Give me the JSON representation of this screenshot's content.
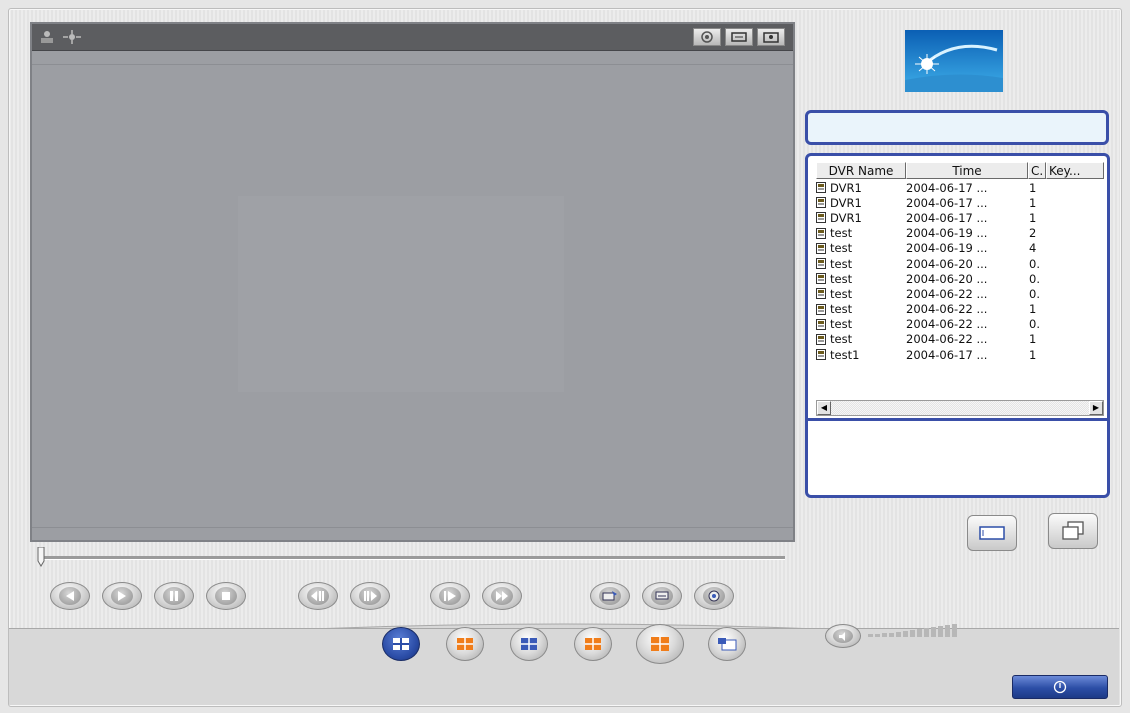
{
  "window": {
    "accent": "#3a4fa8",
    "video_bg": "#9c9ea3"
  },
  "video_toolbar": {
    "left_icons": [
      "network-icon",
      "ptz-icon"
    ],
    "right_buttons": [
      "snapshot-icon",
      "print-icon",
      "record-icon"
    ]
  },
  "playback": {
    "slider_position": 0,
    "controls": [
      "rewind-icon",
      "play-icon",
      "pause-icon",
      "stop-icon",
      "step-back-icon",
      "step-forward-icon",
      "slow-icon",
      "fast-icon",
      "save-clip-icon",
      "print-icon",
      "snapshot-icon"
    ]
  },
  "split_modes": [
    "split-1-icon",
    "split-4-icon",
    "split-6-icon",
    "split-9-icon",
    "split-16-icon",
    "sequence-icon"
  ],
  "search_box": {
    "value": ""
  },
  "event_list": {
    "columns": [
      "DVR Name",
      "Time",
      "C.",
      "Key..."
    ],
    "rows": [
      {
        "name": "DVR1",
        "time": "2004-06-17 ...",
        "ch": "1"
      },
      {
        "name": "DVR1",
        "time": "2004-06-17 ...",
        "ch": "1"
      },
      {
        "name": "DVR1",
        "time": "2004-06-17 ...",
        "ch": "1"
      },
      {
        "name": "test",
        "time": "2004-06-19 ...",
        "ch": "2"
      },
      {
        "name": "test",
        "time": "2004-06-19 ...",
        "ch": "4"
      },
      {
        "name": "test",
        "time": "2004-06-20 ...",
        "ch": "0."
      },
      {
        "name": "test",
        "time": "2004-06-20 ...",
        "ch": "0."
      },
      {
        "name": "test",
        "time": "2004-06-22 ...",
        "ch": "0."
      },
      {
        "name": "test",
        "time": "2004-06-22 ...",
        "ch": "1"
      },
      {
        "name": "test",
        "time": "2004-06-22 ...",
        "ch": "0."
      },
      {
        "name": "test",
        "time": "2004-06-22 ...",
        "ch": "1"
      },
      {
        "name": "test1",
        "time": "2004-06-17 ...",
        "ch": "1"
      }
    ]
  },
  "side_buttons": [
    "single-view-icon",
    "multi-window-icon"
  ],
  "volume": {
    "level": 0
  },
  "power_button": "power-icon"
}
